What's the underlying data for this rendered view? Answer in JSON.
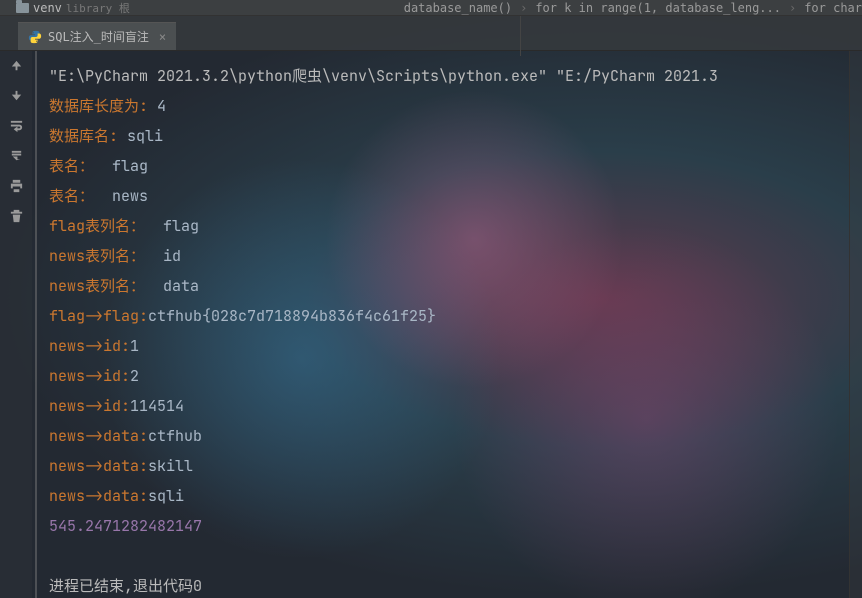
{
  "projectTree": {
    "folder": "venv",
    "suffix": "library 根"
  },
  "breadcrumb": {
    "items": [
      "database_name()",
      "for k in range(1, database_leng...",
      "for char"
    ]
  },
  "tab": {
    "title": "SQL注入_时间盲注"
  },
  "console": {
    "cmd": "\"E:\\PyCharm 2021.3.2\\python爬虫\\venv\\Scripts\\python.exe\" \"E:/PyCharm 2021.3",
    "lines": [
      {
        "label": "数据库长度为: ",
        "value": "4"
      },
      {
        "label": "数据库名: ",
        "value": "sqli"
      },
      {
        "label": "表名：  ",
        "value": "flag"
      },
      {
        "label": "表名：  ",
        "value": "news"
      },
      {
        "label": "flag表列名：  ",
        "value": "flag"
      },
      {
        "label": "news表列名：  ",
        "value": "id"
      },
      {
        "label": "news表列名：  ",
        "value": "data"
      },
      {
        "label": "flag->flag:",
        "value": "ctfhub{028c7d718894b836f4c61f25}"
      },
      {
        "label": "news->id:",
        "value": "1"
      },
      {
        "label": "news->id:",
        "value": "2"
      },
      {
        "label": "news->id:",
        "value": "114514"
      },
      {
        "label": "news->data:",
        "value": "ctfhub"
      },
      {
        "label": "news->data:",
        "value": "skill"
      },
      {
        "label": "news->data:",
        "value": "sqli"
      }
    ],
    "time": "545.2471282482147",
    "exit": "进程已结束,退出代码0"
  }
}
